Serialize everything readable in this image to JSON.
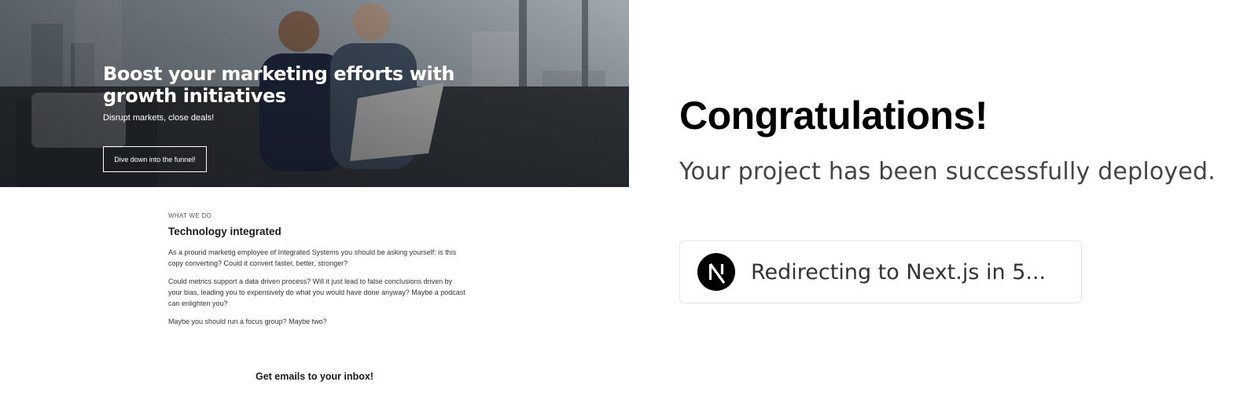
{
  "preview": {
    "hero": {
      "title": "Boost your marketing efforts with growth initiatives",
      "subtitle": "Disrupt markets, close deals!",
      "cta_label": "Dive down into the funnel!"
    },
    "section": {
      "eyebrow": "WHAT WE DO",
      "title": "Technology integrated",
      "paragraphs": [
        "As a pround marketig employee of Integrated Systems you should be asking yourself: is this copy converting? Could it convert faster, better, stronger?",
        "Could metrics support a data driven process? Will it just lead to false conclusions driven by your bias, leading you to expensively do what you would have done anyway? Maybe a podcast can enlighten you?",
        "Maybe you should run a focus group? Maybe two?"
      ]
    },
    "newsletter_heading": "Get emails to your inbox!"
  },
  "deploy": {
    "heading": "Congratulations!",
    "message": "Your project has been successfully deployed.",
    "redirect_text": "Redirecting to Next.js in 5...",
    "logo_icon": "nextjs-logo-icon"
  },
  "colors": {
    "heading": "#000000",
    "message": "#444444",
    "card_border": "#e5e5e5",
    "logo_bg": "#000000"
  }
}
